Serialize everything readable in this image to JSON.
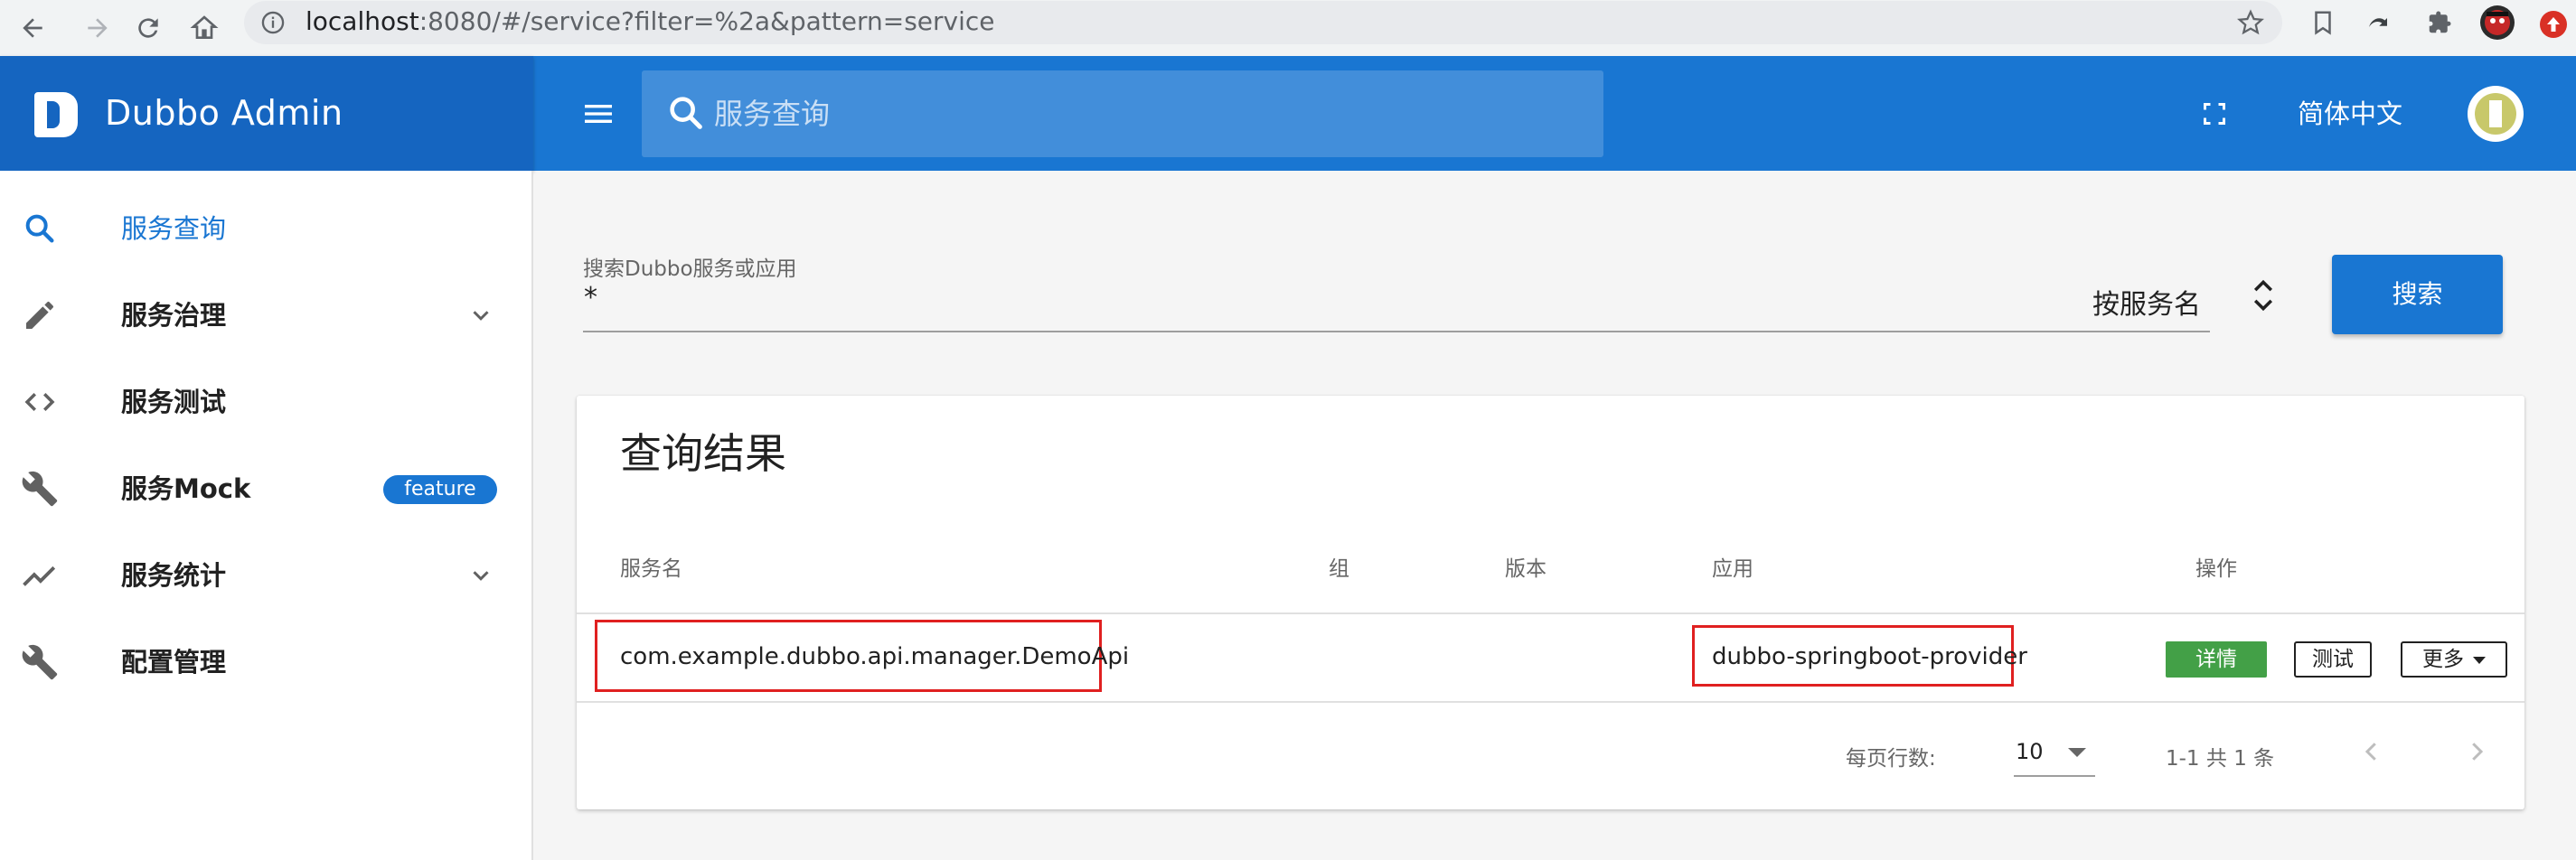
{
  "browser": {
    "url_host": "localhost",
    "url_rest": ":8080/#/service?filter=%2a&pattern=service",
    "icons": [
      "back-icon",
      "forward-icon",
      "reload-icon",
      "home-icon",
      "info-icon",
      "star-icon",
      "bookmark-icon",
      "sync-icon",
      "extensions-icon",
      "profile-icon",
      "update-icon"
    ]
  },
  "app": {
    "title": "Dubbo Admin",
    "search_placeholder": "服务查询",
    "language": "简体中文"
  },
  "sidebar": {
    "items": [
      {
        "label": "服务查询",
        "icon": "search-icon"
      },
      {
        "label": "服务治理",
        "icon": "pencil-icon",
        "expandable": true
      },
      {
        "label": "服务测试",
        "icon": "code-icon"
      },
      {
        "label": "服务Mock",
        "icon": "wrench-icon",
        "badge": "feature"
      },
      {
        "label": "服务统计",
        "icon": "trending-icon",
        "expandable": true
      },
      {
        "label": "配置管理",
        "icon": "wrench-icon"
      }
    ]
  },
  "search": {
    "label": "搜索Dubbo服务或应用",
    "value": "*",
    "type_value": "按服务名",
    "button": "搜索"
  },
  "results": {
    "title": "查询结果",
    "headers": {
      "service": "服务名",
      "group": "组",
      "version": "版本",
      "app": "应用",
      "actions": "操作"
    },
    "rows": [
      {
        "service": "com.example.dubbo.api.manager.DemoApi",
        "group": "",
        "version": "",
        "app": "dubbo-springboot-provider",
        "detail": "详情",
        "test": "测试",
        "more": "更多"
      }
    ],
    "pagination": {
      "rows_per_page_label": "每页行数:",
      "rows_per_page": "10",
      "range": "1-1 共 1 条"
    }
  },
  "colors": {
    "primary": "#1976d2",
    "brand_bar": "#1565c0",
    "detail_button": "#43a047",
    "highlight": "#e02020"
  }
}
